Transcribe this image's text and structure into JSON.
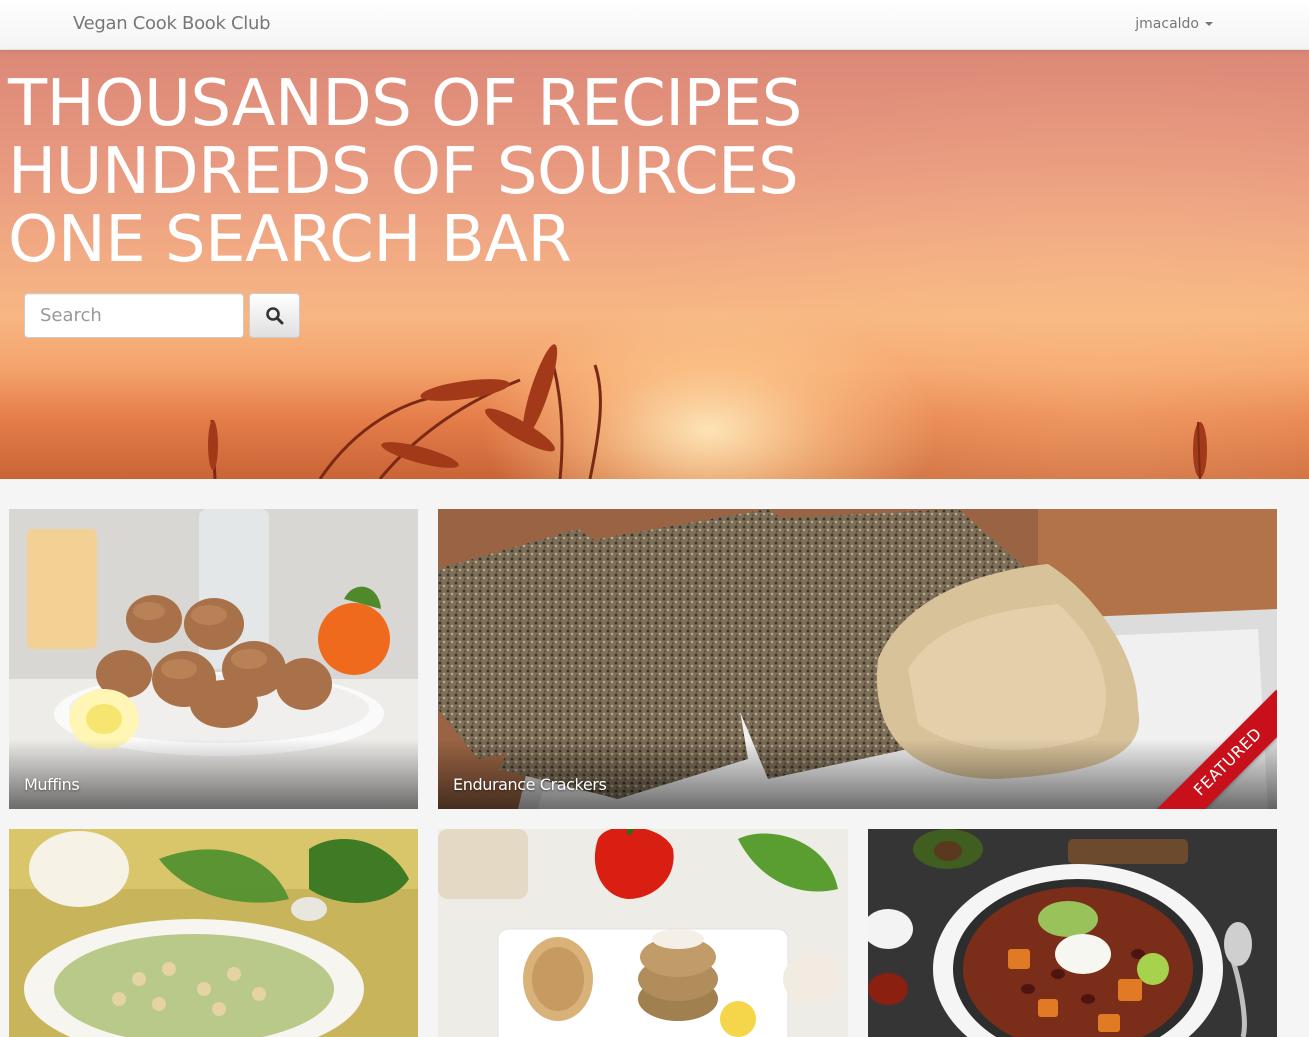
{
  "navbar": {
    "brand": "Vegan Cook Book Club",
    "user": "jmacaldo"
  },
  "hero": {
    "lines": [
      "THOUSANDS OF RECIPES",
      "HUNDREDS OF SOURCES",
      "ONE SEARCH BAR"
    ],
    "search": {
      "placeholder": "Search",
      "value": ""
    },
    "search_button_icon": "search-icon"
  },
  "recipes": [
    {
      "title": "Muffins",
      "featured": false
    },
    {
      "title": "Endurance Crackers",
      "featured": true,
      "badge": "FEATURED"
    },
    {
      "title": "",
      "featured": false
    },
    {
      "title": "",
      "featured": false
    },
    {
      "title": "",
      "featured": false
    }
  ],
  "colors": {
    "ribbon": "#c8101a",
    "hero_top": "#dc8878",
    "hero_bottom": "#c96436",
    "page_bg": "#f5f5f5"
  }
}
